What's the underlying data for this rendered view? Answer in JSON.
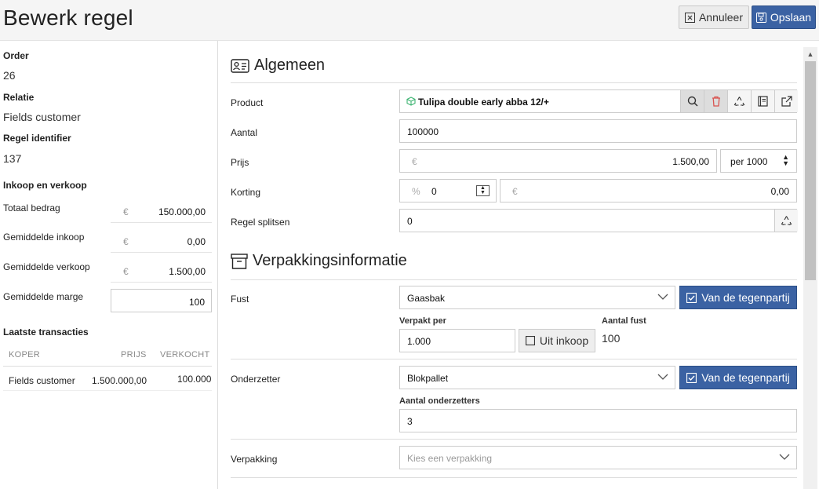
{
  "header": {
    "title": "Bewerk regel",
    "cancel_label": "Annuleer",
    "save_label": "Opslaan"
  },
  "left": {
    "order_label": "Order",
    "order_value": "26",
    "relatie_label": "Relatie",
    "relatie_value": "Fields customer",
    "regel_label": "Regel identifier",
    "regel_value": "137",
    "ik_title": "Inkoop en verkoop",
    "rows": [
      {
        "label": "Totaal bedrag",
        "currency": "€",
        "value": "150.000,00"
      },
      {
        "label": "Gemiddelde inkoop",
        "currency": "€",
        "value": "0,00"
      },
      {
        "label": "Gemiddelde verkoop",
        "currency": "€",
        "value": "1.500,00"
      },
      {
        "label": "Gemiddelde marge",
        "value": "100"
      }
    ],
    "tx_title": "Laatste transacties",
    "tx_headers": [
      "KOPER",
      "PRIJS",
      "VERKOCHT"
    ],
    "tx_rows": [
      [
        "Fields customer",
        "1.500.000,00",
        "100.000"
      ]
    ]
  },
  "algemeen": {
    "title": "Algemeen",
    "product_label": "Product",
    "product_value": "Tulipa double early abba 12/+",
    "aantal_label": "Aantal",
    "aantal_value": "100000",
    "prijs_label": "Prijs",
    "prijs_currency": "€",
    "prijs_value": "1.500,00",
    "prijs_unit": "per 1000",
    "korting_label": "Korting",
    "korting_pct_symbol": "%",
    "korting_pct": "0",
    "korting_currency": "€",
    "korting_value": "0,00",
    "splitsen_label": "Regel splitsen",
    "splitsen_value": "0"
  },
  "verpakking": {
    "title": "Verpakkingsinformatie",
    "fust_label": "Fust",
    "fust_value": "Gaasbak",
    "van_label": "Van de tegenpartij",
    "verpakt_label": "Verpakt per",
    "verpakt_value": "1.000",
    "uit_inkoop_label": "Uit inkoop",
    "aantal_fust_label": "Aantal fust",
    "aantal_fust_value": "100",
    "onderzetter_label": "Onderzetter",
    "onderzetter_value": "Blokpallet",
    "aantal_onderzetters_label": "Aantal onderzetters",
    "aantal_onderzetters_value": "3",
    "verpakking_label": "Verpakking",
    "verpakking_placeholder": "Kies een verpakking"
  },
  "colors": {
    "accent": "#3b62a3",
    "product_icon": "#3cb371",
    "delete_icon": "#d9534f"
  }
}
